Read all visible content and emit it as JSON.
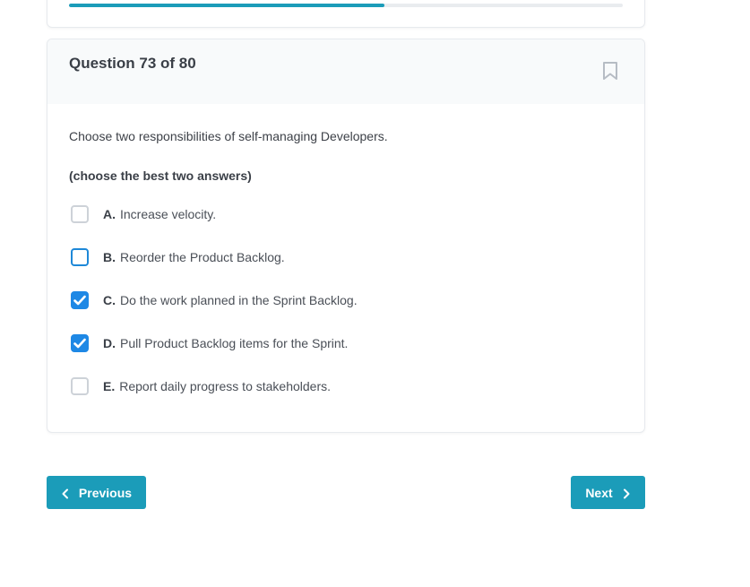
{
  "progress": {
    "fraction": 0.57
  },
  "question": {
    "title": "Question 73 of 80",
    "text": "Choose two responsibilities of self-managing Developers.",
    "instruction": "(choose the best two answers)",
    "bookmark_icon": "bookmark-icon",
    "answers": [
      {
        "letter": "A.",
        "text": "Increase velocity.",
        "checked": false
      },
      {
        "letter": "B.",
        "text": "Reorder the Product Backlog.",
        "checked": false,
        "focused": true
      },
      {
        "letter": "C.",
        "text": "Do the work planned in the Sprint Backlog.",
        "checked": true
      },
      {
        "letter": "D.",
        "text": "Pull Product Backlog items for the Sprint.",
        "checked": true
      },
      {
        "letter": "E.",
        "text": "Report daily progress to stakeholders.",
        "checked": false
      }
    ]
  },
  "navigation": {
    "previous_label": "Previous",
    "next_label": "Next",
    "previous_icon": "chevron-left-icon",
    "next_icon": "chevron-right-icon"
  },
  "colors": {
    "accent": "#1b9cb9",
    "checkbox_checked": "#1e88e5",
    "checkbox_focus": "#1e88d8"
  }
}
